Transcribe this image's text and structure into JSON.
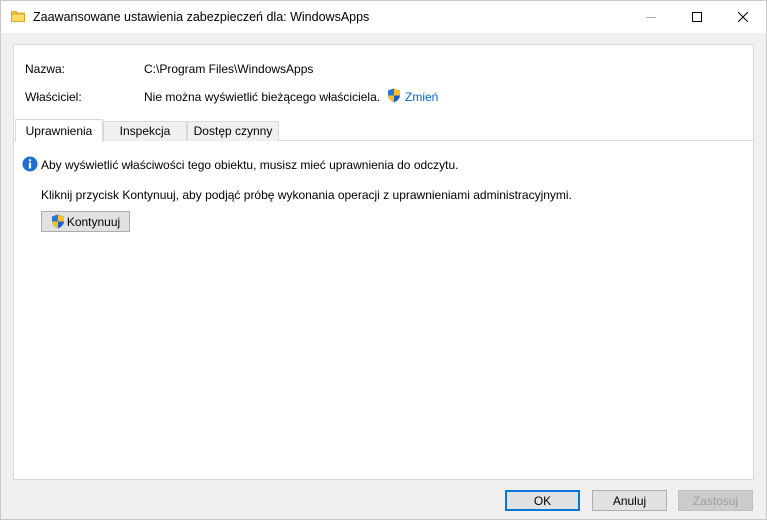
{
  "window": {
    "title": "Zaawansowane ustawienia zabezpieczeń dla: WindowsApps",
    "icons": {
      "title": "folder-icon",
      "minimize": "minimize-icon",
      "maximize": "maximize-icon",
      "close": "close-icon"
    }
  },
  "properties": {
    "name_label": "Nazwa:",
    "name_value": "C:\\Program Files\\WindowsApps",
    "owner_label": "Właściciel:",
    "owner_value": "Nie można wyświetlić bieżącego właściciela.",
    "change_link": "Zmień"
  },
  "tabs": [
    {
      "label": "Uprawnienia",
      "active": true
    },
    {
      "label": "Inspekcja",
      "active": false
    },
    {
      "label": "Dostęp czynny",
      "active": false
    }
  ],
  "message": {
    "info": "Aby wyświetlić właściwości tego obiektu, musisz mieć uprawnienia do odczytu.",
    "instruction": "Kliknij przycisk Kontynuuj, aby podjąć próbę wykonania operacji z uprawnieniami administracyjnymi.",
    "continue_label": "Kontynuuj"
  },
  "buttons": {
    "ok": "OK",
    "cancel": "Anuluj",
    "apply": "Zastosuj"
  },
  "colors": {
    "link": "#0066cc",
    "accent": "#0078d7"
  }
}
